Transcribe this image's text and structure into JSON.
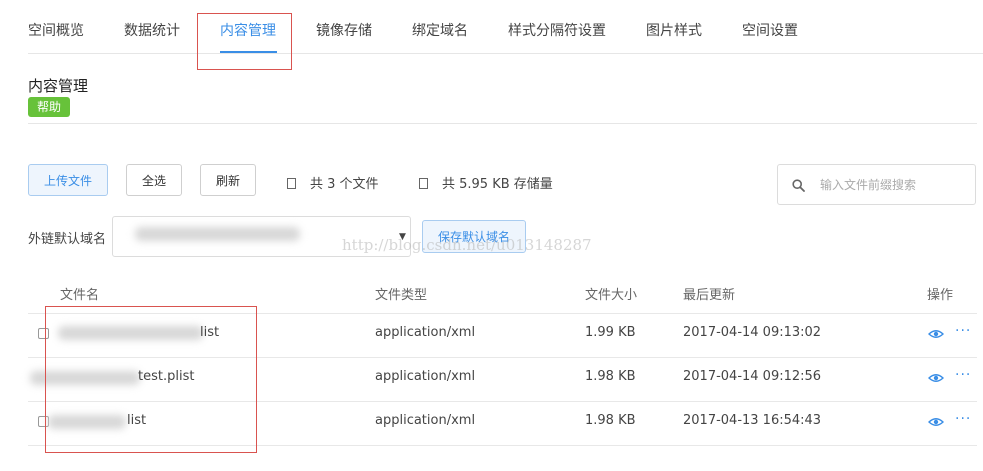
{
  "tabs": [
    {
      "label": "空间概览"
    },
    {
      "label": "数据统计"
    },
    {
      "label": "内容管理",
      "active": true
    },
    {
      "label": "镜像存储"
    },
    {
      "label": "绑定域名"
    },
    {
      "label": "样式分隔符设置"
    },
    {
      "label": "图片样式"
    },
    {
      "label": "空间设置"
    }
  ],
  "section": {
    "title": "内容管理",
    "help": "帮助"
  },
  "toolbar": {
    "upload": "上传文件",
    "select_all": "全选",
    "refresh": "刷新",
    "file_count": "共 3 个文件",
    "storage": "共 5.95 KB 存储量"
  },
  "search": {
    "placeholder": "输入文件前缀搜索"
  },
  "domain": {
    "label": "外链默认域名",
    "save": "保存默认域名"
  },
  "watermark": "http://blog.csdn.net/u013148287",
  "table": {
    "headers": {
      "name": "文件名",
      "type": "文件类型",
      "size": "文件大小",
      "updated": "最后更新",
      "ops": "操作"
    },
    "rows": [
      {
        "name": "list",
        "type": "application/xml",
        "size": "1.99 KB",
        "updated": "2017-04-14 09:13:02"
      },
      {
        "name": "test.plist",
        "type": "application/xml",
        "size": "1.98 KB",
        "updated": "2017-04-14 09:12:56"
      },
      {
        "name": "list",
        "type": "application/xml",
        "size": "1.98 KB",
        "updated": "2017-04-13 16:54:43"
      }
    ],
    "more": "···"
  },
  "colors": {
    "accent": "#3a8ee6",
    "help_badge": "#67c23a",
    "highlight_box": "#d9534f"
  },
  "icons": {
    "search": "search-icon",
    "view": "eye-icon",
    "more": "more-icon",
    "stat": "square-icon"
  }
}
